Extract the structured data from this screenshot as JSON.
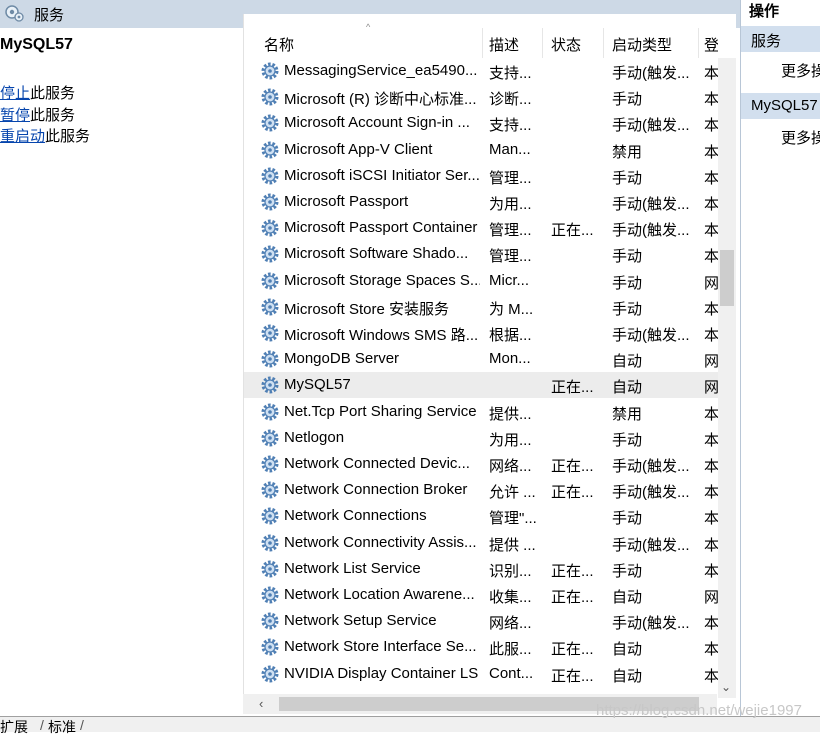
{
  "window": {
    "title": "服务",
    "title_icon": "services-icon"
  },
  "left_pane": {
    "selected_service": "MySQL57",
    "actions": [
      {
        "link": "停止",
        "rest": "此服务"
      },
      {
        "link": "暂停",
        "rest": "此服务"
      },
      {
        "link": "重启动",
        "rest": "此服务"
      }
    ]
  },
  "columns": {
    "name": "名称",
    "description": "描述",
    "status": "状态",
    "startup": "启动类型",
    "logon": "登"
  },
  "services": [
    {
      "name": "MessagingService_ea5490...",
      "description": "支持...",
      "status": "",
      "startup": "手动(触发...",
      "logon": "本"
    },
    {
      "name": "Microsoft (R) 诊断中心标准...",
      "description": "诊断...",
      "status": "",
      "startup": "手动",
      "logon": "本"
    },
    {
      "name": "Microsoft Account Sign-in ...",
      "description": "支持...",
      "status": "",
      "startup": "手动(触发...",
      "logon": "本"
    },
    {
      "name": "Microsoft App-V Client",
      "description": "Man...",
      "status": "",
      "startup": "禁用",
      "logon": "本"
    },
    {
      "name": "Microsoft iSCSI Initiator Ser...",
      "description": "管理...",
      "status": "",
      "startup": "手动",
      "logon": "本"
    },
    {
      "name": "Microsoft Passport",
      "description": "为用...",
      "status": "",
      "startup": "手动(触发...",
      "logon": "本"
    },
    {
      "name": "Microsoft Passport Container",
      "description": "管理...",
      "status": "正在...",
      "startup": "手动(触发...",
      "logon": "本"
    },
    {
      "name": "Microsoft Software Shado...",
      "description": "管理...",
      "status": "",
      "startup": "手动",
      "logon": "本"
    },
    {
      "name": "Microsoft Storage Spaces S...",
      "description": "Micr...",
      "status": "",
      "startup": "手动",
      "logon": "网"
    },
    {
      "name": "Microsoft Store 安装服务",
      "description": "为 M...",
      "status": "",
      "startup": "手动",
      "logon": "本"
    },
    {
      "name": "Microsoft Windows SMS 路...",
      "description": "根据...",
      "status": "",
      "startup": "手动(触发...",
      "logon": "本"
    },
    {
      "name": "MongoDB Server",
      "description": "Mon...",
      "status": "",
      "startup": "自动",
      "logon": "网"
    },
    {
      "name": "MySQL57",
      "description": "",
      "status": "正在...",
      "startup": "自动",
      "logon": "网",
      "selected": true
    },
    {
      "name": "Net.Tcp Port Sharing Service",
      "description": "提供...",
      "status": "",
      "startup": "禁用",
      "logon": "本"
    },
    {
      "name": "Netlogon",
      "description": "为用...",
      "status": "",
      "startup": "手动",
      "logon": "本"
    },
    {
      "name": "Network Connected Devic...",
      "description": "网络...",
      "status": "正在...",
      "startup": "手动(触发...",
      "logon": "本"
    },
    {
      "name": "Network Connection Broker",
      "description": "允许 ...",
      "status": "正在...",
      "startup": "手动(触发...",
      "logon": "本"
    },
    {
      "name": "Network Connections",
      "description": "管理\"...",
      "status": "",
      "startup": "手动",
      "logon": "本"
    },
    {
      "name": "Network Connectivity Assis...",
      "description": "提供 ...",
      "status": "",
      "startup": "手动(触发...",
      "logon": "本"
    },
    {
      "name": "Network List Service",
      "description": "识别...",
      "status": "正在...",
      "startup": "手动",
      "logon": "本"
    },
    {
      "name": "Network Location Awarene...",
      "description": "收集...",
      "status": "正在...",
      "startup": "自动",
      "logon": "网"
    },
    {
      "name": "Network Setup Service",
      "description": "网络...",
      "status": "",
      "startup": "手动(触发...",
      "logon": "本"
    },
    {
      "name": "Network Store Interface Se...",
      "description": "此服...",
      "status": "正在...",
      "startup": "自动",
      "logon": "本"
    },
    {
      "name": "NVIDIA Display Container LS",
      "description": "Cont...",
      "status": "正在...",
      "startup": "自动",
      "logon": "本"
    }
  ],
  "right_pane": {
    "title": "操作",
    "groups": [
      {
        "label": "服务",
        "more": "更多操"
      },
      {
        "label": "MySQL57",
        "more": "更多操"
      }
    ]
  },
  "bottom_tabs": [
    "扩展",
    "标准"
  ],
  "watermark": "https://blog.csdn.net/wejie1997",
  "colors": {
    "titlebar": "#cdd9e6",
    "link": "#0645ad",
    "group_band": "#d2dfee",
    "selected_row": "#ececec"
  }
}
